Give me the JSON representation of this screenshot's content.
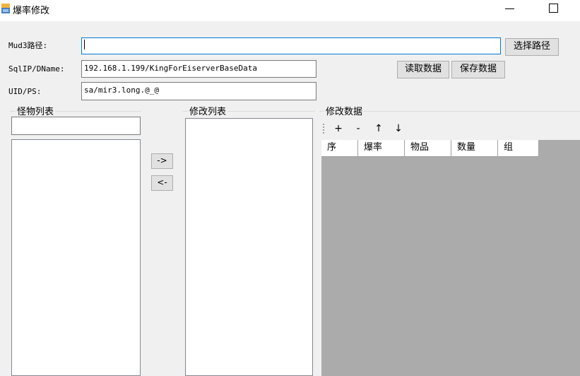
{
  "window": {
    "title": "爆率修改"
  },
  "form": {
    "mud3_label": "Mud3路径:",
    "mud3_value": "",
    "select_path_label": "选择路径",
    "sql_label": "SqlIP/DName:",
    "sql_value": "192.168.1.199/KingForEiserverBaseData",
    "uid_label": "UID/PS:",
    "uid_value": "sa/mir3.long.@_@",
    "read_data_label": "读取数据",
    "save_data_label": "保存数据"
  },
  "monster_group": {
    "title": "怪物列表",
    "search_value": ""
  },
  "transfer": {
    "add_label": "->",
    "remove_label": "<-"
  },
  "modify_list_group": {
    "title": "修改列表"
  },
  "modify_data_group": {
    "title": "修改数据",
    "toolbar": {
      "add": "+",
      "remove": "-",
      "up": "↑",
      "down": "↓"
    },
    "columns": [
      "序",
      "爆率",
      "物品",
      "数量",
      "组"
    ]
  }
}
